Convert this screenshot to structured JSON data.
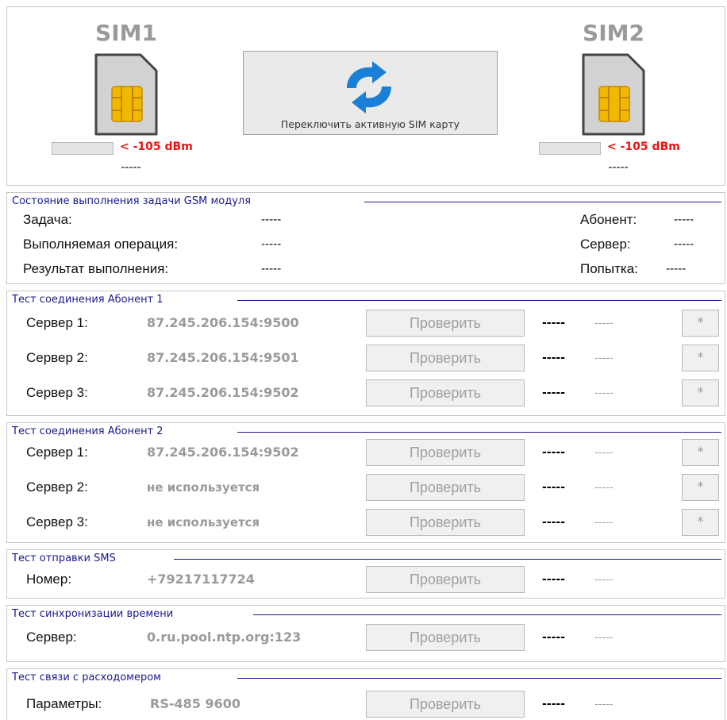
{
  "sim1": {
    "title": "SIM1",
    "signal_text": "< -105 dBm",
    "signal_level": 0,
    "status": "-----"
  },
  "sim2": {
    "title": "SIM2",
    "signal_text": "< -105 dBm",
    "signal_level": 0,
    "status": "-----"
  },
  "switch_button": {
    "label": "Переключить активную SIM карту",
    "icon": "sync-icon"
  },
  "gsm_status": {
    "legend": "Состояние выполнения задачи GSM модуля",
    "task_label": "Задача:",
    "task_value": "-----",
    "operation_label": "Выполняемая операция:",
    "operation_value": "-----",
    "result_label": "Результат выполнения:",
    "result_value": "-----",
    "subscriber_label": "Абонент:",
    "subscriber_value": "-----",
    "server_label": "Сервер:",
    "server_value": "-----",
    "attempt_label": "Попытка:",
    "attempt_value": "-----"
  },
  "conn_test_1": {
    "legend": "Тест соединения Абонент 1",
    "rows": [
      {
        "label": "Сервер 1:",
        "value": "87.245.206.154:9500",
        "button": "Проверить",
        "result": "-----",
        "detail": "-----",
        "star": "*"
      },
      {
        "label": "Сервер 2:",
        "value": "87.245.206.154:9501",
        "button": "Проверить",
        "result": "-----",
        "detail": "-----",
        "star": "*"
      },
      {
        "label": "Сервер 3:",
        "value": "87.245.206.154:9502",
        "button": "Проверить",
        "result": "-----",
        "detail": "-----",
        "star": "*"
      }
    ]
  },
  "conn_test_2": {
    "legend": "Тест соединения Абонент 2",
    "rows": [
      {
        "label": "Сервер 1:",
        "value": "87.245.206.154:9502",
        "button": "Проверить",
        "result": "-----",
        "detail": "-----",
        "star": "*"
      },
      {
        "label": "Сервер 2:",
        "value": "не используется",
        "button": "Проверить",
        "result": "-----",
        "detail": "-----",
        "star": "*"
      },
      {
        "label": "Сервер 3:",
        "value": "не используется",
        "button": "Проверить",
        "result": "-----",
        "detail": "-----",
        "star": "*"
      }
    ]
  },
  "sms_test": {
    "legend": "Тест отправки SMS",
    "label": "Номер:",
    "value": "+79217117724",
    "button": "Проверить",
    "result": "-----",
    "detail": "-----"
  },
  "time_sync_test": {
    "legend": "Тест синхронизации времени",
    "label": "Сервер:",
    "value": "0.ru.pool.ntp.org:123",
    "button": "Проверить",
    "result": "-----",
    "detail": "-----"
  },
  "meter_test": {
    "legend": "Тест связи с расходомером",
    "label": "Параметры:",
    "value": "RS-485 9600",
    "button": "Проверить",
    "result": "-----",
    "detail": "-----"
  },
  "colors": {
    "legend": "#1a1a8c",
    "signal_warning": "#ee1111",
    "icon_blue": "#1a7fd6"
  }
}
